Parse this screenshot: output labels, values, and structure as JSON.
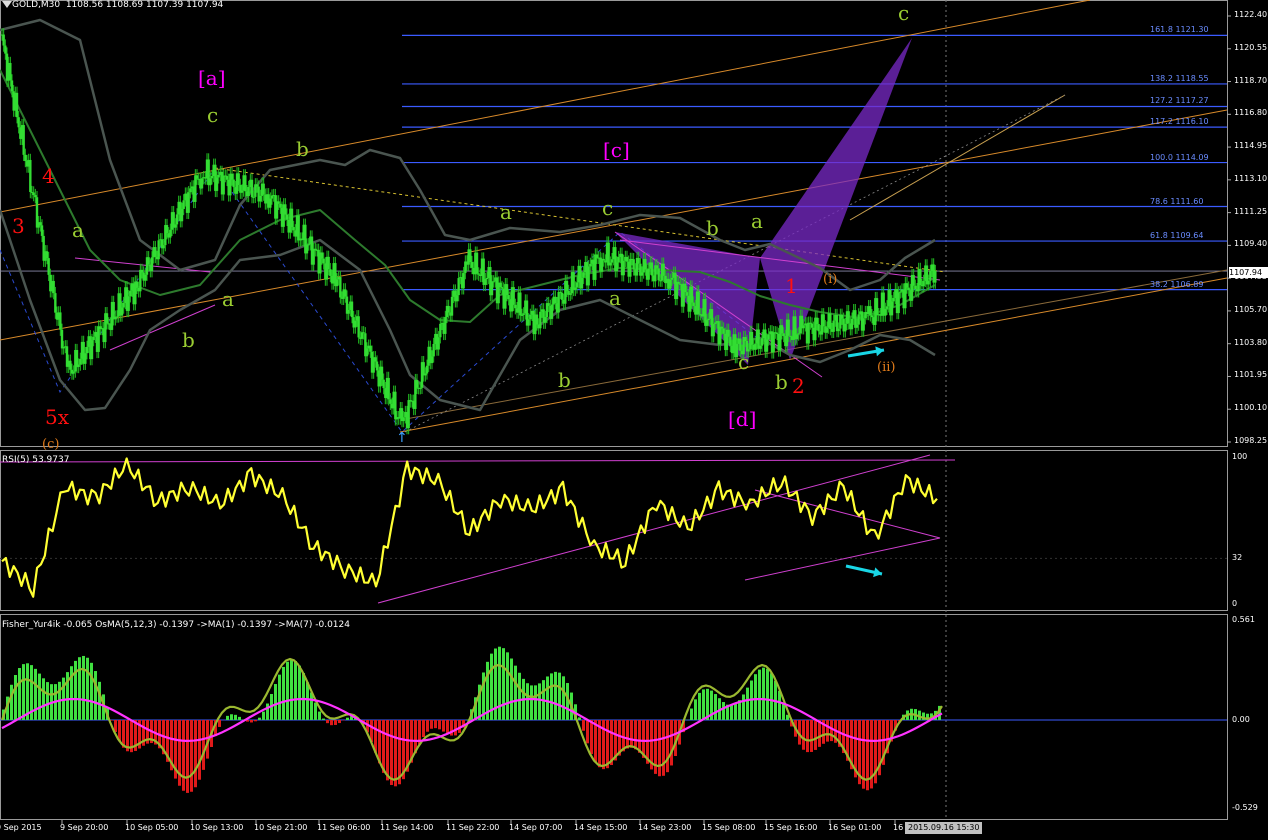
{
  "header": {
    "symbol": "GOLD,M30",
    "ohlc": "1108.56 1108.69 1107.39 1107.94",
    "rsi_label": "RSI(5) 53.9737",
    "fisher_label": "Fisher_Yur4ik -0.065  OsMA(5,12,3) -0.1397  ->MA(1) -0.1397  ->MA(7) -0.0124"
  },
  "price_axis": {
    "labels": [
      "1122.40",
      "1120.55",
      "1118.70",
      "1116.80",
      "1114.95",
      "1113.10",
      "1111.25",
      "1109.40",
      "1107.55",
      "1105.70",
      "1103.80",
      "1101.95",
      "1100.10",
      "1098.25"
    ],
    "current": "1107.94"
  },
  "rsi_axis": {
    "labels": [
      "100",
      "32",
      "0"
    ]
  },
  "fisher_axis": {
    "labels": [
      "0.561",
      "0.00",
      "-0.529"
    ]
  },
  "time_axis": {
    "labels": [
      "9 Sep 2015",
      "9 Sep 20:00",
      "10 Sep 05:00",
      "10 Sep 13:00",
      "10 Sep 21:00",
      "11 Sep 06:00",
      "11 Sep 14:00",
      "11 Sep 22:00",
      "14 Sep 07:00",
      "14 Sep 15:00",
      "14 Sep 23:00",
      "15 Sep 08:00",
      "15 Sep 16:00",
      "16 Sep 01:00",
      "16"
    ],
    "current": "2015.09.16 15:30"
  },
  "fib_levels": [
    {
      "label": "161.8  1121.30"
    },
    {
      "label": "138.2  1118.55"
    },
    {
      "label": "127.2  1117.27"
    },
    {
      "label": "117.2  1116.10"
    },
    {
      "label": "100.0   1114.09"
    },
    {
      "label": "78.6  1111.60"
    },
    {
      "label": "61.8  1109.64"
    },
    {
      "label": "38.2  1106.89"
    }
  ],
  "wave_labels": [
    {
      "text": "[a]"
    },
    {
      "text": "c"
    },
    {
      "text": "b"
    },
    {
      "text": "4"
    },
    {
      "text": "3"
    },
    {
      "text": "a"
    },
    {
      "text": "a"
    },
    {
      "text": "b"
    },
    {
      "text": "5x"
    },
    {
      "text": "(c)"
    },
    {
      "text": "b"
    },
    {
      "text": "a"
    },
    {
      "text": "c"
    },
    {
      "text": "[c]"
    },
    {
      "text": "b"
    },
    {
      "text": "a"
    },
    {
      "text": "a"
    },
    {
      "text": "b"
    },
    {
      "text": "c"
    },
    {
      "text": "[d]"
    },
    {
      "text": "1"
    },
    {
      "text": "2"
    },
    {
      "text": "(i)"
    },
    {
      "text": "(ii)"
    },
    {
      "text": "c"
    }
  ],
  "chart_data": {
    "type": "line",
    "symbol": "GOLD",
    "timeframe": "M30",
    "ylim": [
      1097.9,
      1123.4
    ],
    "price_series": {
      "name": "GOLD close",
      "x": [
        "9 Sep 2015",
        "9 Sep 20:00",
        "10 Sep 05:00",
        "10 Sep 13:00",
        "10 Sep 21:00",
        "11 Sep 06:00",
        "11 Sep 14:00",
        "11 Sep 22:00",
        "14 Sep 07:00",
        "14 Sep 15:00",
        "14 Sep 23:00",
        "15 Sep 08:00",
        "15 Sep 16:00",
        "16 Sep 01:00",
        "2015.09.16 15:30"
      ],
      "values": [
        1121.0,
        1102.2,
        1107.0,
        1113.5,
        1112.2,
        1107.5,
        1099.2,
        1108.5,
        1105.0,
        1108.8,
        1107.6,
        1103.6,
        1104.6,
        1105.3,
        1107.94
      ]
    },
    "fib_levels": [
      {
        "ratio": 161.8,
        "price": 1121.3
      },
      {
        "ratio": 138.2,
        "price": 1118.55
      },
      {
        "ratio": 127.2,
        "price": 1117.27
      },
      {
        "ratio": 117.2,
        "price": 1116.1
      },
      {
        "ratio": 100.0,
        "price": 1114.09
      },
      {
        "ratio": 78.6,
        "price": 1111.6
      },
      {
        "ratio": 61.8,
        "price": 1109.64
      },
      {
        "ratio": 38.2,
        "price": 1106.89
      }
    ],
    "current_price": 1107.94,
    "rsi": {
      "period": 5,
      "value": 53.9737,
      "ylim": [
        0,
        100
      ],
      "level": 32,
      "values": [
        30,
        12,
        80,
        72,
        95,
        70,
        80,
        68,
        88,
        74,
        40,
        25,
        15,
        92,
        84,
        50,
        72,
        65,
        78,
        40,
        30,
        70,
        52,
        78,
        68,
        84,
        60,
        80,
        45,
        85,
        72
      ]
    },
    "osma": {
      "fast": 5,
      "slow": 12,
      "signal": 3,
      "value": -0.1397,
      "ma1": -0.1397,
      "ma7": -0.0124,
      "ylim": [
        -0.529,
        0.561
      ]
    },
    "fisher": {
      "value": -0.065
    }
  }
}
